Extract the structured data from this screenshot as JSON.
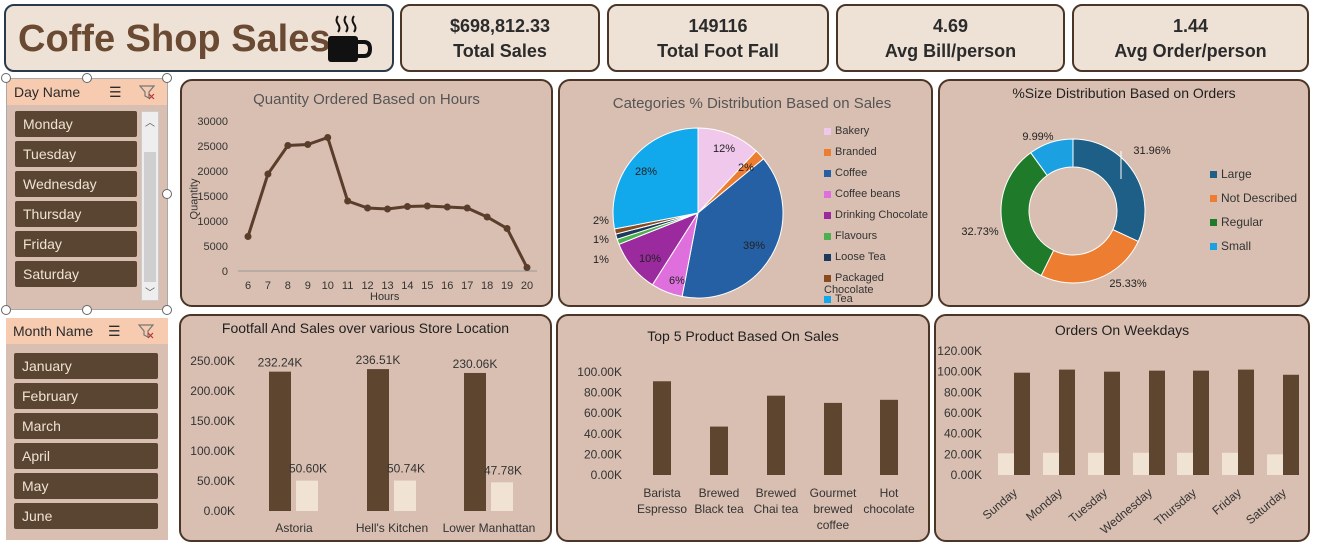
{
  "header": {
    "title": "Coffe Shop Sales",
    "icon": "coffee-cup-icon"
  },
  "kpis": [
    {
      "value": "$698,812.33",
      "label": "Total Sales"
    },
    {
      "value": "149116",
      "label": "Total Foot Fall"
    },
    {
      "value": "4.69",
      "label": "Avg Bill/person"
    },
    {
      "value": "1.44",
      "label": "Avg Order/person"
    }
  ],
  "slicers": {
    "day": {
      "title": "Day Name",
      "items": [
        "Monday",
        "Tuesday",
        "Wednesday",
        "Thursday",
        "Friday",
        "Saturday"
      ]
    },
    "month": {
      "title": "Month Name",
      "items": [
        "January",
        "February",
        "March",
        "April",
        "May",
        "June"
      ]
    }
  },
  "colors": {
    "brown": "#5e4530",
    "cream": "#f0e3d3",
    "panel": "#d9bfb1",
    "line": "#5a3e2b"
  },
  "chart_data": [
    {
      "type": "line",
      "title": "Quantity  Ordered Based on Hours",
      "xlabel": "Hours",
      "ylabel": "Quantity",
      "x": [
        6,
        7,
        8,
        9,
        10,
        11,
        12,
        13,
        14,
        15,
        16,
        17,
        18,
        19,
        20
      ],
      "values": [
        6900,
        19400,
        25100,
        25300,
        26700,
        14000,
        12600,
        12400,
        12900,
        13000,
        12800,
        12600,
        10800,
        8500,
        700
      ],
      "ylim": [
        0,
        30000
      ],
      "yticks": [
        "30000",
        "25000",
        "20000",
        "15000",
        "10000",
        "5000",
        "0"
      ]
    },
    {
      "type": "pie",
      "title": "Categories % Distribution Based on Sales",
      "slices": [
        {
          "name": "Bakery",
          "value": 12,
          "label": "12%",
          "color": "#f0c8ec"
        },
        {
          "name": "Branded",
          "value": 2,
          "label": "2%",
          "color": "#ed7d31"
        },
        {
          "name": "Coffee",
          "value": 39,
          "label": "39%",
          "color": "#2660a4"
        },
        {
          "name": "Coffee beans",
          "value": 6,
          "label": "6%",
          "color": "#df6fdc"
        },
        {
          "name": "Drinking Chocolate",
          "value": 10,
          "label": "10%",
          "color": "#9b2a9e"
        },
        {
          "name": "Flavours",
          "value": 1,
          "label": "1%",
          "color": "#4caf50"
        },
        {
          "name": "Loose Tea",
          "value": 1,
          "label": "1%",
          "color": "#1b3a5c"
        },
        {
          "name": "Packaged Chocolate",
          "value": 1,
          "label": "2%",
          "color": "#8a4a1f"
        },
        {
          "name": "Tea",
          "value": 28,
          "label": "28%",
          "color": "#11a9ec"
        }
      ]
    },
    {
      "type": "pie",
      "title": "%Size Distribution Based on Orders",
      "slices": [
        {
          "name": "Large",
          "value": 31.96,
          "label": "31.96%",
          "color": "#1d5f86"
        },
        {
          "name": "Not Described",
          "value": 25.33,
          "label": "25.33%",
          "color": "#ed7d31"
        },
        {
          "name": "Regular",
          "value": 32.73,
          "label": "32.73%",
          "color": "#1f7a2a"
        },
        {
          "name": "Small",
          "value": 9.99,
          "label": "9.99%",
          "color": "#1ba1e2"
        }
      ]
    },
    {
      "type": "bar",
      "title": "Footfall And Sales over various Store Location",
      "categories": [
        "Astoria",
        "Hell's Kitchen",
        "Lower Manhattan"
      ],
      "series": [
        {
          "values": [
            232240,
            236510,
            230060
          ],
          "labels": [
            "232.24K",
            "236.51K",
            "230.06K"
          ]
        },
        {
          "values": [
            50600,
            50740,
            47780
          ],
          "labels": [
            "50.60K",
            "50.74K",
            "47.78K"
          ]
        }
      ],
      "ylim": [
        0,
        250000
      ],
      "yticks": [
        "250.00K",
        "200.00K",
        "150.00K",
        "100.00K",
        "50.00K",
        "0.00K"
      ]
    },
    {
      "type": "bar",
      "title": "Top 5 Product Based On Sales",
      "categories": [
        [
          "Barista",
          "Espresso"
        ],
        [
          "Brewed",
          "Black tea"
        ],
        [
          "Brewed",
          "Chai tea"
        ],
        [
          "Gourmet",
          "brewed",
          "coffee"
        ],
        [
          "Hot",
          "chocolate"
        ]
      ],
      "values": [
        91000,
        47000,
        77000,
        70000,
        73000
      ],
      "ylim": [
        0,
        100000
      ],
      "yticks": [
        "100.00K",
        "80.00K",
        "60.00K",
        "40.00K",
        "20.00K",
        "0.00K"
      ]
    },
    {
      "type": "bar",
      "title": "Orders On Weekdays",
      "categories": [
        "Sunday",
        "Monday",
        "Tuesday",
        "Wednesday",
        "Thursday",
        "Friday",
        "Saturday"
      ],
      "series": [
        {
          "values": [
            21000,
            21500,
            21500,
            21500,
            21500,
            21500,
            20000
          ]
        },
        {
          "values": [
            99000,
            102000,
            100000,
            101000,
            101000,
            102000,
            97000
          ]
        }
      ],
      "ylim": [
        0,
        120000
      ],
      "yticks": [
        "120.00K",
        "100.00K",
        "80.00K",
        "60.00K",
        "40.00K",
        "20.00K",
        "0.00K"
      ]
    }
  ]
}
